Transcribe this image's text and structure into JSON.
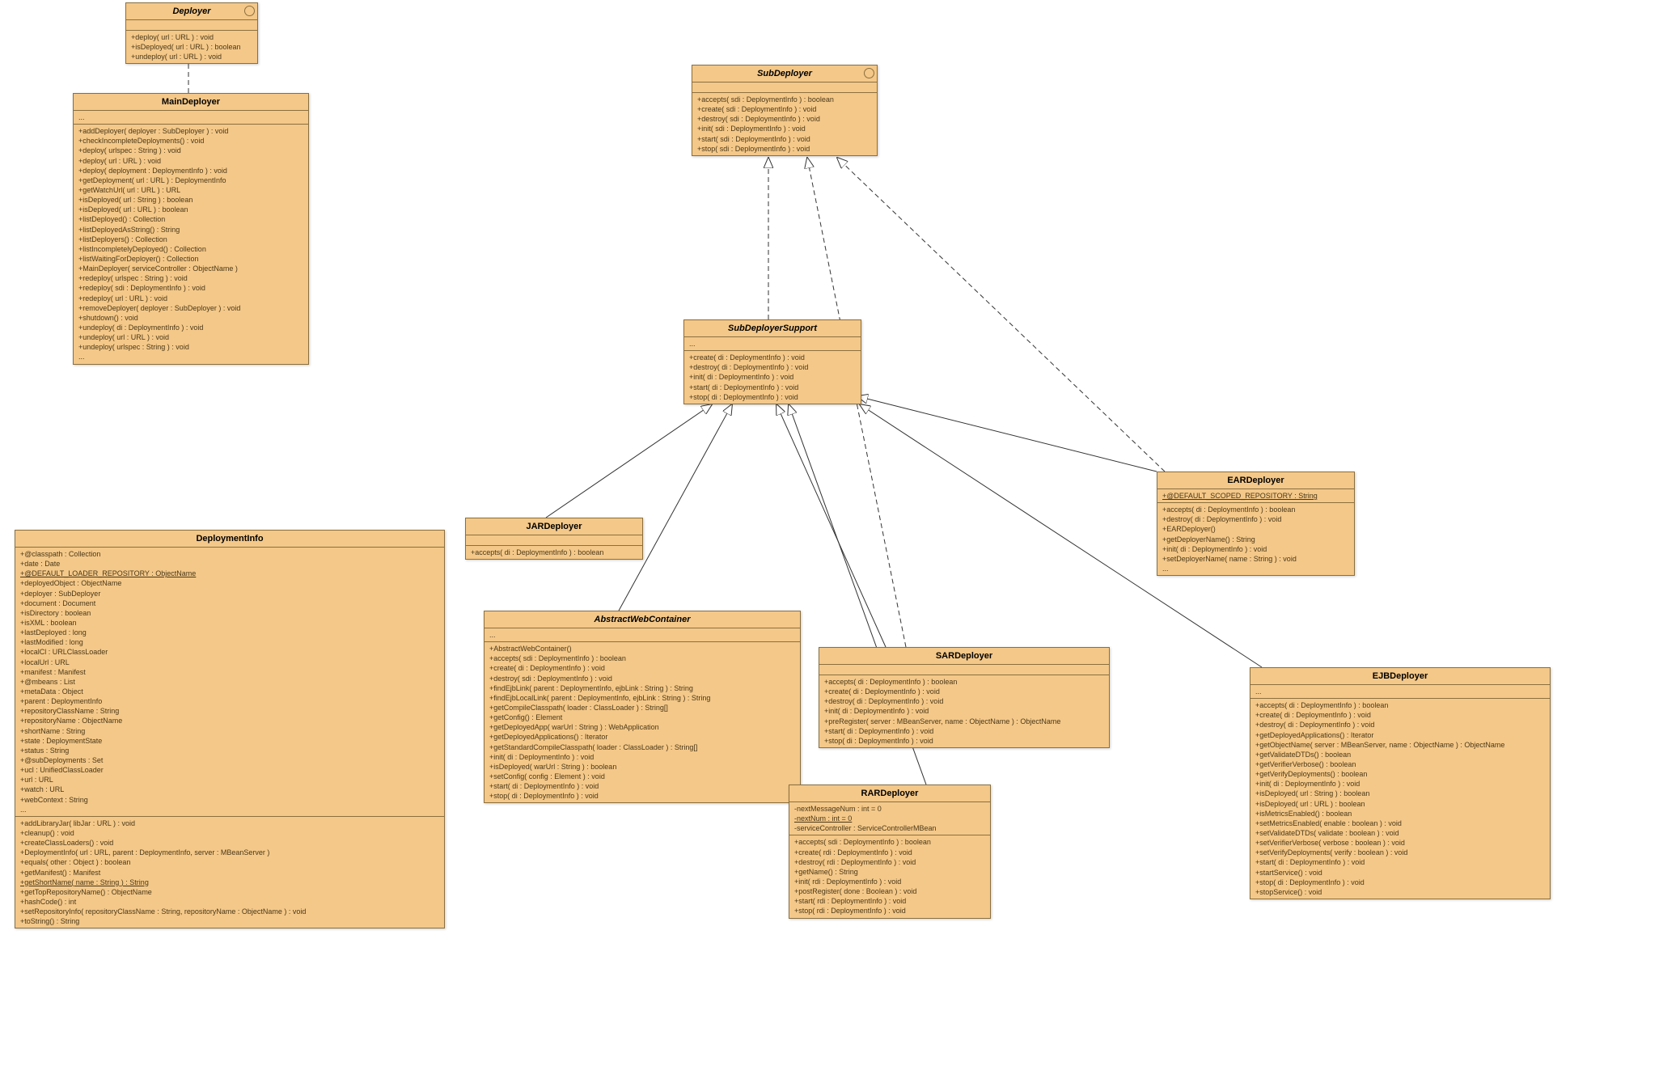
{
  "classes": {
    "deployer": {
      "name": "Deployer",
      "methods": [
        "+deploy( url : URL ) : void",
        "+isDeployed( url : URL ) : boolean",
        "+undeploy( url : URL ) : void"
      ]
    },
    "mainDeployer": {
      "name": "MainDeployer",
      "attrs": [
        "..."
      ],
      "methods": [
        "+addDeployer( deployer : SubDeployer ) : void",
        "+checkIncompleteDeployments() : void",
        "+deploy( urlspec : String ) : void",
        "+deploy( url : URL ) : void",
        "+deploy( deployment : DeploymentInfo ) : void",
        "+getDeployment( url : URL ) : DeploymentInfo",
        "+getWatchUrl( url : URL ) : URL",
        "+isDeployed( url : String ) : boolean",
        "+isDeployed( url : URL ) : boolean",
        "+listDeployed() : Collection",
        "+listDeployedAsString() : String",
        "+listDeployers() : Collection",
        "+listIncompletelyDeployed() : Collection",
        "+listWaitingForDeployer() : Collection",
        "+MainDeployer( serviceController : ObjectName )",
        "+redeploy( urlspec : String ) : void",
        "+redeploy( sdi : DeploymentInfo ) : void",
        "+redeploy( url : URL ) : void",
        "+removeDeployer( deployer : SubDeployer ) : void",
        "+shutdown() : void",
        "+undeploy( di : DeploymentInfo ) : void",
        "+undeploy( url : URL ) : void",
        "+undeploy( urlspec : String ) : void",
        "..."
      ]
    },
    "deploymentInfo": {
      "name": "DeploymentInfo",
      "attrs": [
        "+@classpath : Collection",
        "+date : Date",
        {
          "text": "+@DEFAULT_LOADER_REPOSITORY : ObjectName",
          "underline": true
        },
        "+deployedObject : ObjectName",
        "+deployer : SubDeployer",
        "+document : Document",
        "+isDirectory : boolean",
        "+isXML : boolean",
        "+lastDeployed : long",
        "+lastModified : long",
        "+localCl : URLClassLoader",
        "+localUrl : URL",
        "+manifest : Manifest",
        "+@mbeans : List",
        "+metaData : Object",
        "+parent : DeploymentInfo",
        "+repositoryClassName : String",
        "+repositoryName : ObjectName",
        "+shortName : String",
        "+state : DeploymentState",
        "+status : String",
        "+@subDeployments : Set",
        "+ucl : UnifiedClassLoader",
        "+url : URL",
        "+watch : URL",
        "+webContext : String",
        "..."
      ],
      "methods": [
        "+addLibraryJar( libJar : URL ) : void",
        "+cleanup() : void",
        "+createClassLoaders() : void",
        "+DeploymentInfo( url : URL, parent : DeploymentInfo, server : MBeanServer )",
        "+equals( other : Object ) : boolean",
        "+getManifest() : Manifest",
        {
          "text": "+getShortName( name : String ) : String",
          "underline": true
        },
        "+getTopRepositoryName() : ObjectName",
        "+hashCode() : int",
        "+setRepositoryInfo( repositoryClassName : String, repositoryName : ObjectName ) : void",
        "+toString() : String"
      ]
    },
    "subDeployer": {
      "name": "SubDeployer",
      "methods": [
        "+accepts( sdi : DeploymentInfo ) : boolean",
        "+create( sdi : DeploymentInfo ) : void",
        "+destroy( sdi : DeploymentInfo ) : void",
        "+init( sdi : DeploymentInfo ) : void",
        "+start( sdi : DeploymentInfo ) : void",
        "+stop( sdi : DeploymentInfo ) : void"
      ]
    },
    "subDeployerSupport": {
      "name": "SubDeployerSupport",
      "attrs": [
        "..."
      ],
      "methods": [
        "+create( di : DeploymentInfo ) : void",
        "+destroy( di : DeploymentInfo ) : void",
        "+init( di : DeploymentInfo ) : void",
        "+start( di : DeploymentInfo ) : void",
        "+stop( di : DeploymentInfo ) : void"
      ]
    },
    "jarDeployer": {
      "name": "JARDeployer",
      "methods": [
        "+accepts( di : DeploymentInfo ) : boolean"
      ]
    },
    "earDeployer": {
      "name": "EARDeployer",
      "attrs": [
        {
          "text": "+@DEFAULT_SCOPED_REPOSITORY : String",
          "underline": true
        }
      ],
      "methods": [
        "+accepts( di : DeploymentInfo ) : boolean",
        "+destroy( di : DeploymentInfo ) : void",
        "+EARDeployer()",
        "+getDeployerName() : String",
        "+init( di : DeploymentInfo ) : void",
        "+setDeployerName( name : String ) : void",
        "..."
      ]
    },
    "abstractWebContainer": {
      "name": "AbstractWebContainer",
      "attrs": [
        "..."
      ],
      "methods": [
        "+AbstractWebContainer()",
        "+accepts( sdi : DeploymentInfo ) : boolean",
        "+create( di : DeploymentInfo ) : void",
        "+destroy( sdi : DeploymentInfo ) : void",
        "+findEjbLink( parent : DeploymentInfo, ejbLink : String ) : String",
        "+findEjbLocalLink( parent : DeploymentInfo, ejbLink : String ) : String",
        "+getCompileClasspath( loader : ClassLoader ) : String[]",
        "+getConfig() : Element",
        "+getDeployedApp( warUrl : String ) : WebApplication",
        "+getDeployedApplications() : Iterator",
        "+getStandardCompileClasspath( loader : ClassLoader ) : String[]",
        "+init( di : DeploymentInfo ) : void",
        "+isDeployed( warUrl : String ) : boolean",
        "+setConfig( config : Element ) : void",
        "+start( di : DeploymentInfo ) : void",
        "+stop( di : DeploymentInfo ) : void"
      ]
    },
    "sarDeployer": {
      "name": "SARDeployer",
      "methods": [
        "+accepts( di : DeploymentInfo ) : boolean",
        "+create( di : DeploymentInfo ) : void",
        "+destroy( di : DeploymentInfo ) : void",
        "+init( di : DeploymentInfo ) : void",
        "+preRegister( server : MBeanServer, name : ObjectName ) : ObjectName",
        "+start( di : DeploymentInfo ) : void",
        "+stop( di : DeploymentInfo ) : void"
      ]
    },
    "rarDeployer": {
      "name": "RARDeployer",
      "attrs": [
        "-nextMessageNum : int = 0",
        {
          "text": "-nextNum : int = 0",
          "underline": true
        },
        "-serviceController : ServiceControllerMBean"
      ],
      "methods": [
        "+accepts( sdi : DeploymentInfo ) : boolean",
        "+create( rdi : DeploymentInfo ) : void",
        "+destroy( rdi : DeploymentInfo ) : void",
        "+getName() : String",
        "+init( rdi : DeploymentInfo ) : void",
        "+postRegister( done : Boolean ) : void",
        "+start( rdi : DeploymentInfo ) : void",
        "+stop( rdi : DeploymentInfo ) : void"
      ]
    },
    "ejbDeployer": {
      "name": "EJBDeployer",
      "attrs": [
        "..."
      ],
      "methods": [
        "+accepts( di : DeploymentInfo ) : boolean",
        "+create( di : DeploymentInfo ) : void",
        "+destroy( di : DeploymentInfo ) : void",
        "+getDeployedApplications() : Iterator",
        "+getObjectName( server : MBeanServer, name : ObjectName ) : ObjectName",
        "+getValidateDTDs() : boolean",
        "+getVerifierVerbose() : boolean",
        "+getVerifyDeployments() : boolean",
        "+init( di : DeploymentInfo ) : void",
        "+isDeployed( url : String ) : boolean",
        "+isDeployed( url : URL ) : boolean",
        "+isMetricsEnabled() : boolean",
        "+setMetricsEnabled( enable : boolean ) : void",
        "+setValidateDTDs( validate : boolean ) : void",
        "+setVerifierVerbose( verbose : boolean ) : void",
        "+setVerifyDeployments( verify : boolean ) : void",
        "+start( di : DeploymentInfo ) : void",
        "+startService() : void",
        "+stop( di : DeploymentInfo ) : void",
        "+stopService() : void"
      ]
    }
  }
}
